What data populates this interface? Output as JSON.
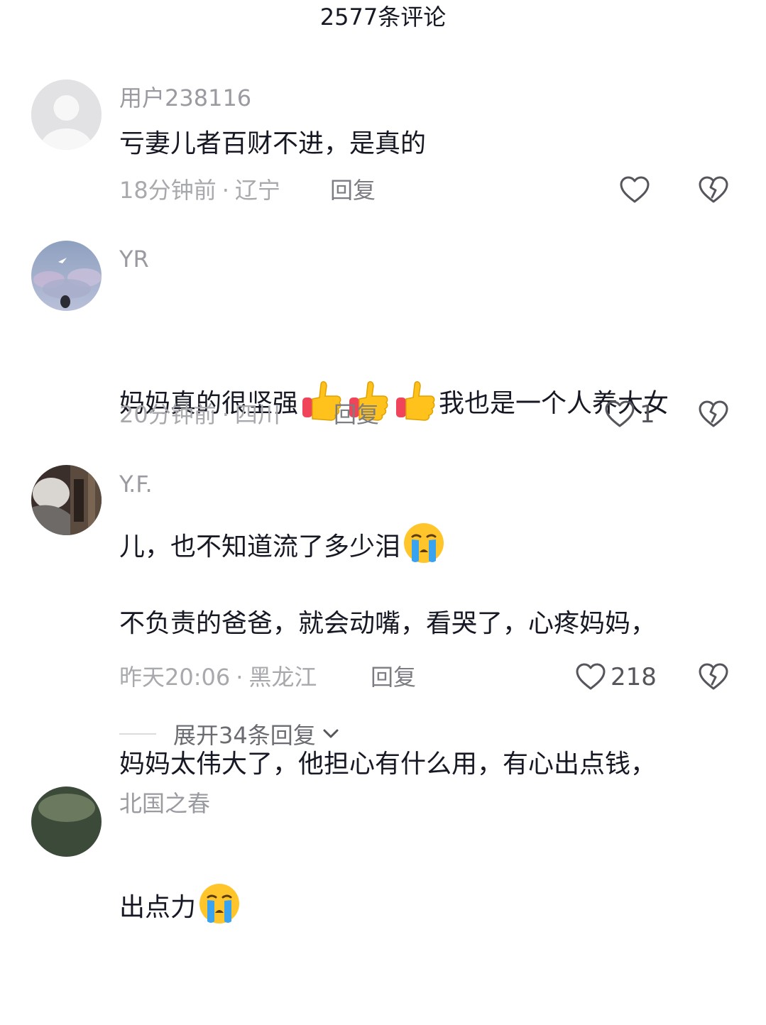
{
  "header": {
    "title": "2577条评论"
  },
  "colors": {
    "text_primary": "#161823",
    "text_secondary": "#a8a9ad",
    "icon_stroke": "#55565b"
  },
  "comments": [
    {
      "username": "用户238116",
      "avatar": "default-user-avatar",
      "text": "亏妻儿者百财不进，是真的",
      "time": "18分钟前",
      "location": "辽宁",
      "reply_label": "回复",
      "likes": ""
    },
    {
      "username": "YR",
      "avatar": "sky-landscape-avatar",
      "text_line1_a": "妈妈真的很坚强",
      "text_line1_b": "我也是一个人养大女",
      "text_line2": "儿，也不知道流了多少泪",
      "emojis": [
        "thumbs-up-emoji",
        "thumbs-up-emoji",
        "thumbs-up-emoji",
        "crying-face-emoji"
      ],
      "time": "20分钟前",
      "location": "四川",
      "reply_label": "回复",
      "likes": "1"
    },
    {
      "username": "Y.F.",
      "avatar": "dark-photo-avatar",
      "text_line1": "不负责的爸爸，就会动嘴，看哭了，心疼妈妈，",
      "text_line2": "妈妈太伟大了，他担心有什么用，有心出点钱，",
      "text_line3": "出点力",
      "emojis": [
        "crying-face-emoji"
      ],
      "time": "昨天20:06",
      "location": "黑龙江",
      "reply_label": "回复",
      "likes": "218",
      "expand_label": "展开34条回复"
    },
    {
      "username": "北国之春",
      "avatar": "partial-avatar"
    }
  ],
  "separator": "·"
}
